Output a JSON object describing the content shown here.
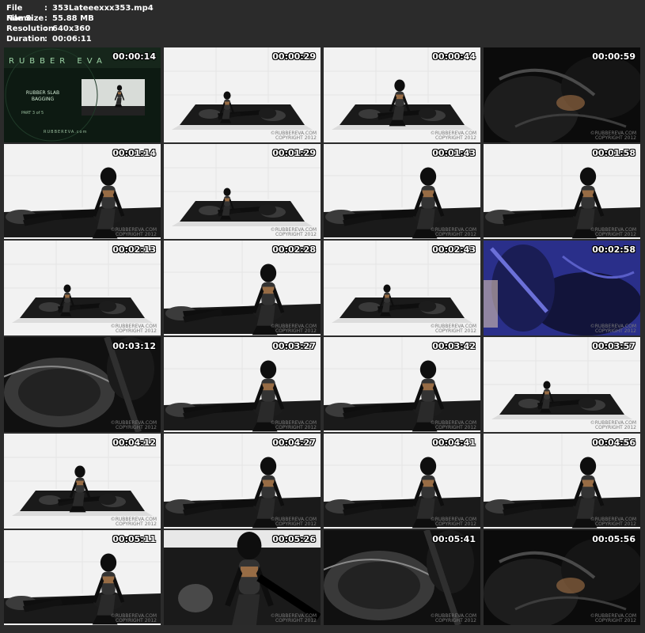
{
  "file_info": {
    "rows": [
      {
        "key": "File Name",
        "value": "353Lateeexxx353.mp4"
      },
      {
        "key": "File Size",
        "value": "55.88 MB"
      },
      {
        "key": "Resolution",
        "value": "640x360"
      },
      {
        "key": "Duration",
        "value": "00:06:11"
      }
    ]
  },
  "intro": {
    "brand": "RUBBER EVA",
    "title": "RUBBER SLAB BAGGING",
    "part": "PART 3 of 5",
    "url": "RUBBEREVA.com"
  },
  "watermark": {
    "line1": "©RUBBEREVA.COM",
    "line2": "COPYRIGHT 2012"
  },
  "thumbnails": [
    {
      "time": "00:00:14",
      "scene": "intro"
    },
    {
      "time": "00:00:29",
      "scene": "wide"
    },
    {
      "time": "00:00:44",
      "scene": "wide-kneel"
    },
    {
      "time": "00:00:59",
      "scene": "closeup-dark"
    },
    {
      "time": "00:01:14",
      "scene": "medium"
    },
    {
      "time": "00:01:29",
      "scene": "wide"
    },
    {
      "time": "00:01:43",
      "scene": "medium"
    },
    {
      "time": "00:01:58",
      "scene": "medium"
    },
    {
      "time": "00:02:13",
      "scene": "wide"
    },
    {
      "time": "00:02:28",
      "scene": "medium"
    },
    {
      "time": "00:02:43",
      "scene": "wide"
    },
    {
      "time": "00:02:58",
      "scene": "closeup-blue"
    },
    {
      "time": "00:03:12",
      "scene": "closeup-bag"
    },
    {
      "time": "00:03:27",
      "scene": "medium"
    },
    {
      "time": "00:03:42",
      "scene": "medium"
    },
    {
      "time": "00:03:57",
      "scene": "wide"
    },
    {
      "time": "00:04:12",
      "scene": "wide-kneel"
    },
    {
      "time": "00:04:27",
      "scene": "medium"
    },
    {
      "time": "00:04:41",
      "scene": "medium"
    },
    {
      "time": "00:04:56",
      "scene": "medium"
    },
    {
      "time": "00:05:11",
      "scene": "medium"
    },
    {
      "time": "00:05:26",
      "scene": "closeup-floor"
    },
    {
      "time": "00:05:41",
      "scene": "closeup-bag"
    },
    {
      "time": "00:05:56",
      "scene": "closeup-dark"
    }
  ],
  "colors": {
    "background": "#2b2b2b",
    "studio_wall": "#f2f2f2",
    "floor": "#1a1a1a",
    "latex": "#0e0e0e",
    "skin": "#b07a4a",
    "intro_bg": "#0d1a12",
    "blue_tint": "#2a2f8a"
  }
}
